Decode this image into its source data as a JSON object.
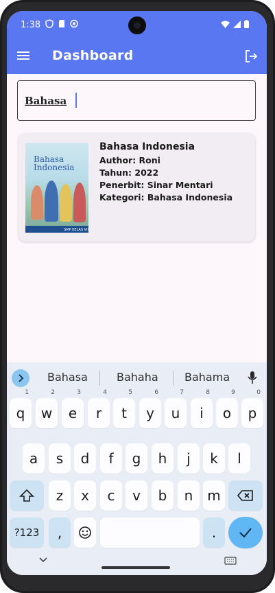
{
  "status": {
    "time": "1:38"
  },
  "appbar": {
    "title": "Dashboard"
  },
  "search": {
    "value": "Bahasa"
  },
  "book": {
    "cover_title_line1": "Bahasa",
    "cover_title_line2": "Indonesia",
    "cover_level": "SMP KELAS VII",
    "title": "Bahasa Indonesia",
    "author": "Author: Roni",
    "year": "Tahun: 2022",
    "publisher": "Penerbit: Sinar Mentari",
    "category": "Kategori: Bahasa Indonesia"
  },
  "keyboard": {
    "suggestions": [
      "Bahasa",
      "Bahaha",
      "Bahama"
    ],
    "row1": [
      "q",
      "w",
      "e",
      "r",
      "t",
      "y",
      "u",
      "i",
      "o",
      "p"
    ],
    "row1_hints": [
      "1",
      "2",
      "3",
      "4",
      "5",
      "6",
      "7",
      "8",
      "9",
      "0"
    ],
    "row2": [
      "a",
      "s",
      "d",
      "f",
      "g",
      "h",
      "j",
      "k",
      "l"
    ],
    "row3": [
      "z",
      "x",
      "c",
      "v",
      "b",
      "n",
      "m"
    ],
    "symbols_key": "?123",
    "comma_key": ",",
    "period_key": "."
  },
  "colors": {
    "primary": "#5a77f2",
    "background": "#fdf7fc",
    "card": "#f2ecf3",
    "keyboard_bg": "#e9eef6",
    "key_accent": "#61b7f4"
  },
  "icons": {
    "menu": "hamburger-icon",
    "logout": "logout-icon",
    "suggestions": "chevron-right-icon",
    "mic": "microphone-icon",
    "shift": "shift-icon",
    "backspace": "backspace-icon",
    "emoji": "emoji-icon",
    "enter": "checkmark-icon",
    "keyboard_hide": "chevron-down-icon",
    "keyboard_switch": "keyboard-icon"
  }
}
